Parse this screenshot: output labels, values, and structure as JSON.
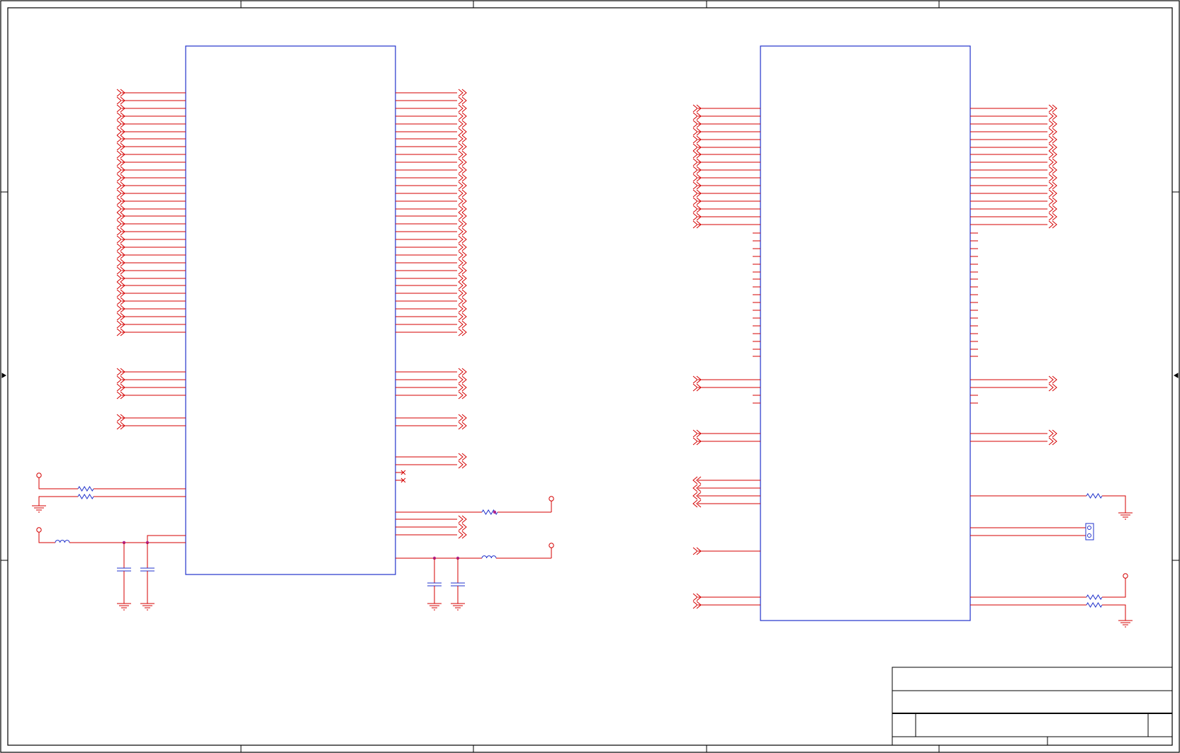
{
  "colors": {
    "background": "#ffffff",
    "frame": "#000000",
    "component_outline": "#2233cc",
    "wire": "#d40000",
    "junction": "#b0238c"
  },
  "title_block": {
    "title": "",
    "sheet": "",
    "size": "",
    "rev": ""
  }
}
